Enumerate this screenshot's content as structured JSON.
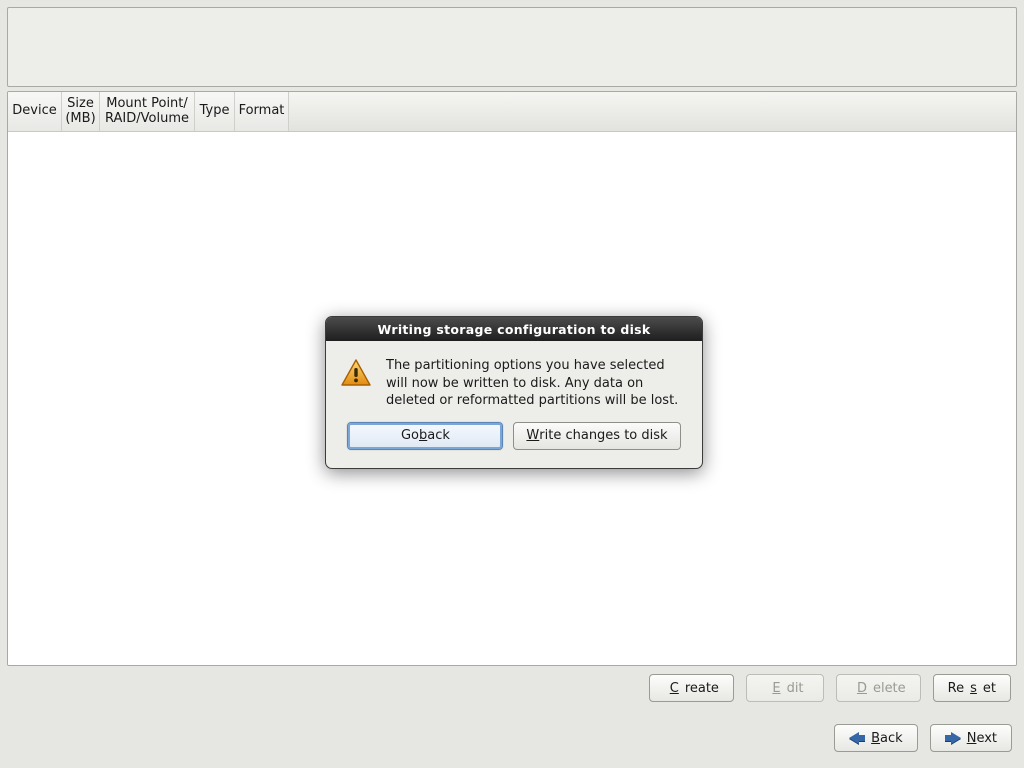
{
  "table": {
    "columns": {
      "device": "Device",
      "size": "Size\n(MB)",
      "mount": "Mount Point/\nRAID/Volume",
      "type": "Type",
      "format": "Format"
    }
  },
  "actions": {
    "create": {
      "pre": "",
      "mn": "C",
      "post": "reate",
      "enabled": true
    },
    "edit": {
      "pre": "",
      "mn": "E",
      "post": "dit",
      "enabled": false
    },
    "delete": {
      "pre": "",
      "mn": "D",
      "post": "elete",
      "enabled": false
    },
    "reset": {
      "pre": "Re",
      "mn": "s",
      "post": "et",
      "enabled": true
    }
  },
  "wizard": {
    "back": {
      "pre": "",
      "mn": "B",
      "post": "ack"
    },
    "next": {
      "pre": "",
      "mn": "N",
      "post": "ext"
    }
  },
  "dialog": {
    "title": "Writing storage configuration to disk",
    "message": "The partitioning options you have selected will now be written to disk.  Any data on deleted or reformatted partitions will be lost.",
    "go_back": {
      "pre": "Go ",
      "mn": "b",
      "post": "ack"
    },
    "write": {
      "pre": "",
      "mn": "W",
      "post": "rite changes to disk"
    }
  }
}
